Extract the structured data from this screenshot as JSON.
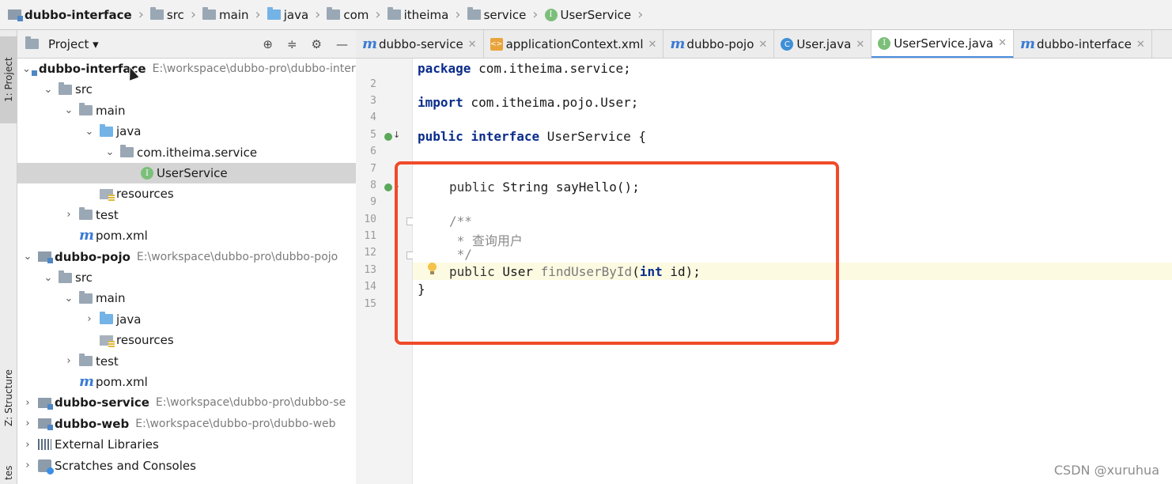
{
  "breadcrumb": [
    {
      "label": "dubbo-interface",
      "icon": "module-icon",
      "bold": true
    },
    {
      "label": "src",
      "icon": "folder-icon"
    },
    {
      "label": "main",
      "icon": "folder-icon"
    },
    {
      "label": "java",
      "icon": "source-folder-icon"
    },
    {
      "label": "com",
      "icon": "package-icon"
    },
    {
      "label": "itheima",
      "icon": "package-icon"
    },
    {
      "label": "service",
      "icon": "package-icon"
    },
    {
      "label": "UserService",
      "icon": "interface-icon"
    }
  ],
  "stripe": {
    "project_tab": "1: Project",
    "structure_tab": "Z: Structure",
    "favorites_tab": "tes"
  },
  "project_panel": {
    "title": "Project"
  },
  "tree": [
    {
      "label": "dubbo-interface",
      "path": "E:\\workspace\\dubbo-pro\\dubbo-interface",
      "indent": 0,
      "chevron": "down",
      "icon": "module",
      "bold": true
    },
    {
      "label": "src",
      "indent": 1,
      "chevron": "down",
      "icon": "folder"
    },
    {
      "label": "main",
      "indent": 2,
      "chevron": "down",
      "icon": "folder"
    },
    {
      "label": "java",
      "indent": 3,
      "chevron": "down",
      "icon": "folder-blue"
    },
    {
      "label": "com.itheima.service",
      "indent": 4,
      "chevron": "down",
      "icon": "package"
    },
    {
      "label": "UserService",
      "indent": 5,
      "chevron": "",
      "icon": "interface",
      "selected": true
    },
    {
      "label": "resources",
      "indent": 3,
      "chevron": "",
      "icon": "resources"
    },
    {
      "label": "test",
      "indent": 2,
      "chevron": "right",
      "icon": "folder"
    },
    {
      "label": "pom.xml",
      "indent": 2,
      "chevron": "",
      "icon": "maven"
    },
    {
      "label": "dubbo-pojo",
      "path": "E:\\workspace\\dubbo-pro\\dubbo-pojo",
      "indent": 0,
      "chevron": "down",
      "icon": "module",
      "bold": true
    },
    {
      "label": "src",
      "indent": 1,
      "chevron": "down",
      "icon": "folder"
    },
    {
      "label": "main",
      "indent": 2,
      "chevron": "down",
      "icon": "folder"
    },
    {
      "label": "java",
      "indent": 3,
      "chevron": "right",
      "icon": "folder-blue"
    },
    {
      "label": "resources",
      "indent": 3,
      "chevron": "",
      "icon": "resources"
    },
    {
      "label": "test",
      "indent": 2,
      "chevron": "right",
      "icon": "folder"
    },
    {
      "label": "pom.xml",
      "indent": 2,
      "chevron": "",
      "icon": "maven"
    },
    {
      "label": "dubbo-service",
      "path": "E:\\workspace\\dubbo-pro\\dubbo-se",
      "indent": 0,
      "chevron": "right",
      "icon": "module",
      "bold": true
    },
    {
      "label": "dubbo-web",
      "path": "E:\\workspace\\dubbo-pro\\dubbo-web",
      "indent": 0,
      "chevron": "right",
      "icon": "module",
      "bold": true
    },
    {
      "label": "External Libraries",
      "indent": 0,
      "chevron": "right",
      "icon": "libraries"
    },
    {
      "label": "Scratches and Consoles",
      "indent": 0,
      "chevron": "right",
      "icon": "scratch"
    }
  ],
  "tabs": [
    {
      "label": "dubbo-service",
      "icon": "maven",
      "closable": true
    },
    {
      "label": "applicationContext.xml",
      "icon": "xml",
      "closable": true
    },
    {
      "label": "dubbo-pojo",
      "icon": "maven",
      "closable": true
    },
    {
      "label": "User.java",
      "icon": "class",
      "closable": true
    },
    {
      "label": "UserService.java",
      "icon": "interface",
      "closable": true,
      "active": true
    },
    {
      "label": "dubbo-interface",
      "icon": "maven",
      "closable": true
    }
  ],
  "code": {
    "line_numbers": [
      "2",
      "3",
      "4",
      "5",
      "6",
      "7",
      "8",
      "9",
      "10",
      "11",
      "12",
      "13",
      "14",
      "15"
    ],
    "line1": {
      "kw": "package",
      "rest": " com.itheima.service;"
    },
    "line3": {
      "kw": "import",
      "rest": " com.itheima.pojo.User;"
    },
    "line5": {
      "kw1": "public",
      "kw2": "interface",
      "rest": " UserService {"
    },
    "line8": {
      "kw": "public",
      "rest": " String sayHello();"
    },
    "line10": "/**",
    "line11": " * 查询用户",
    "line12": " */",
    "line13": {
      "kw": "public",
      "type": " User ",
      "fn": "findUserById",
      "open": "(",
      "kw2": "int",
      "rest": " id);"
    },
    "line14": "}"
  },
  "colors": {
    "highlight_box": "#f04a2a",
    "active_tab_underline": "#4a8fe0",
    "keyword": "#0a2c8a"
  },
  "watermark": "CSDN @xuruhua"
}
